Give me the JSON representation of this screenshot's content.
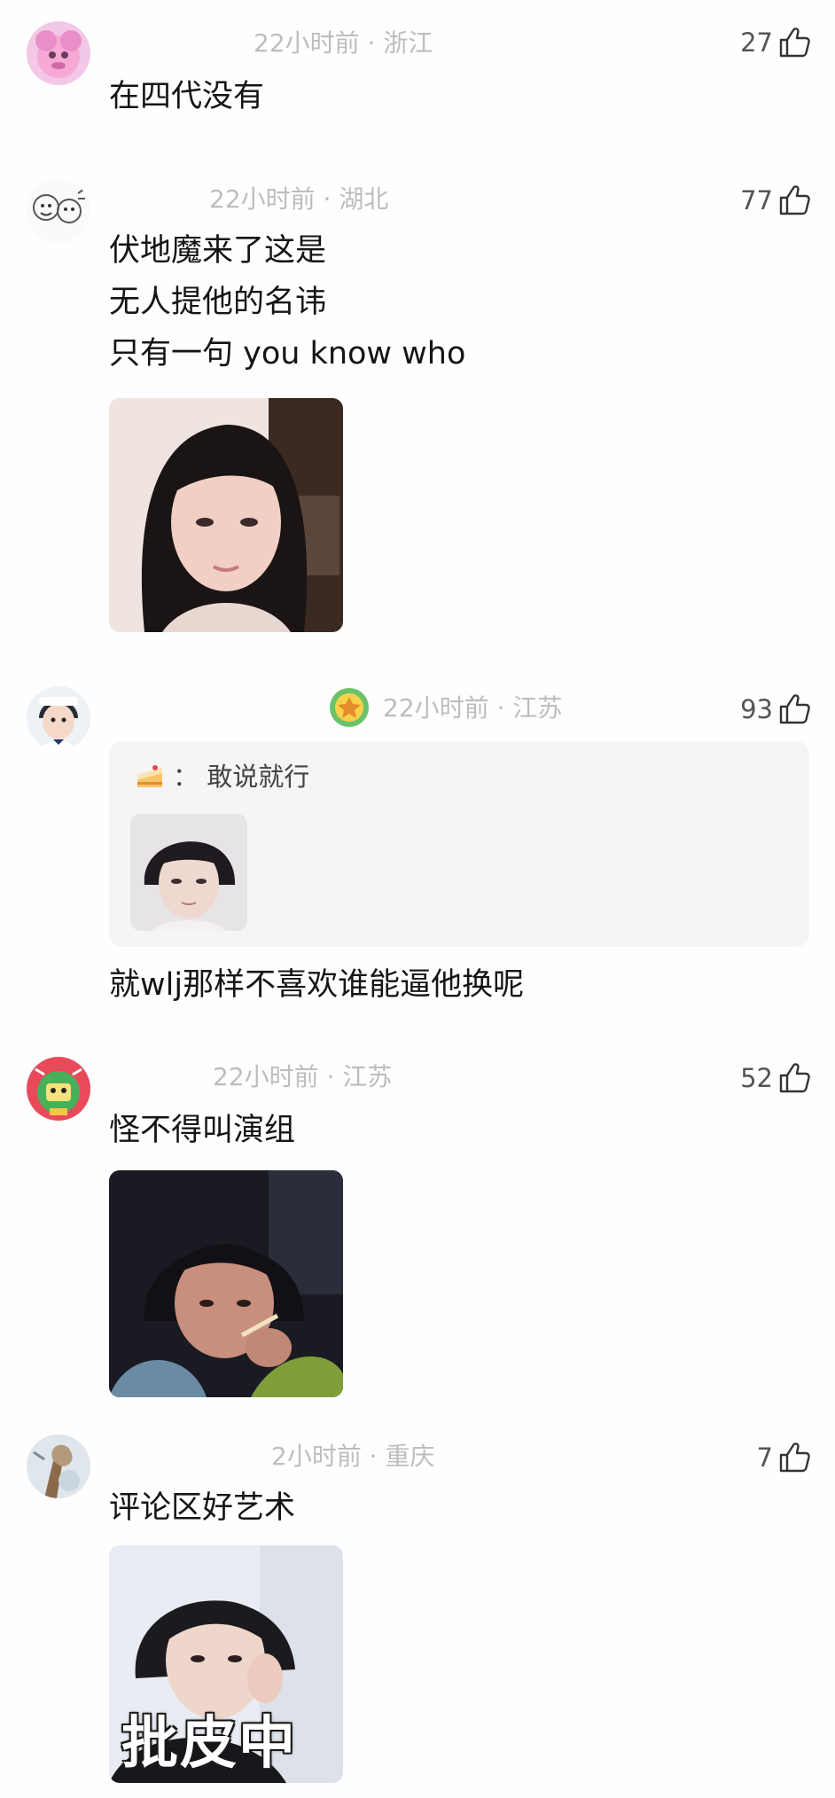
{
  "comments": [
    {
      "meta": "22小时前 · 浙江",
      "likes": "27",
      "lines": [
        "在四代没有"
      ]
    },
    {
      "meta": "22小时前 · 湖北",
      "likes": "77",
      "lines": [
        "伏地魔来了这是",
        "无人提他的名讳",
        "只有一句 you know who"
      ]
    },
    {
      "meta": "22小时前 · 江苏",
      "likes": "93",
      "quote": {
        "text": "： 敢说就行"
      },
      "lines": [
        "就wlj那样不喜欢谁能逼他换呢"
      ]
    },
    {
      "meta": "22小时前 · 江苏",
      "likes": "52",
      "lines": [
        "怪不得叫演组"
      ]
    },
    {
      "meta": "2小时前 · 重庆",
      "likes": "7",
      "lines": [
        "评论区好艺术"
      ],
      "image_caption": "批皮中"
    }
  ],
  "icons": {
    "like": "thumbs-up-outline-icon"
  },
  "colors": {
    "meta_text": "#bdbdbd",
    "body_text": "#151515",
    "quote_bg": "#f5f5f5"
  }
}
